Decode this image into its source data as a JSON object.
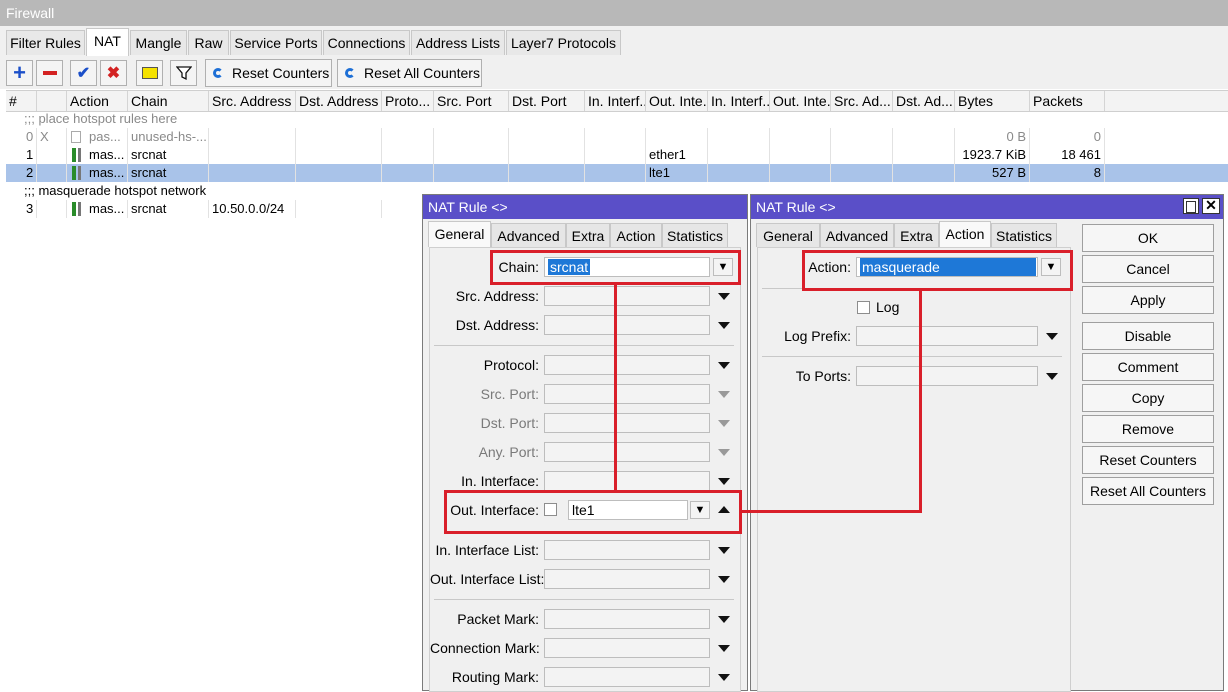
{
  "window_title": "Firewall",
  "main_tabs": [
    "Filter Rules",
    "NAT",
    "Mangle",
    "Raw",
    "Service Ports",
    "Connections",
    "Address Lists",
    "Layer7 Protocols"
  ],
  "toolbar": {
    "add_icon": "plus-icon",
    "remove_icon": "minus-icon",
    "enable_icon": "check-icon",
    "disable_icon": "cross-icon",
    "comment_icon": "note-icon",
    "filter_icon": "funnel-icon",
    "reset_counters": "Reset Counters",
    "reset_all_counters": "Reset All Counters"
  },
  "table": {
    "columns": [
      "#",
      "Action",
      "Chain",
      "Src. Address",
      "Dst. Address",
      "Proto...",
      "Src. Port",
      "Dst. Port",
      "In. Interf...",
      "Out. Inte...",
      "In. Interf...",
      "Out. Inte...",
      "Src. Ad...",
      "Dst. Ad...",
      "Bytes",
      "Packets"
    ],
    "comment1": ";;; place hotspot rules here",
    "rows": [
      {
        "num": "0",
        "flag": "X",
        "action": "pas...",
        "chain": "unused-hs-...",
        "src": "",
        "out": "",
        "bytes": "0 B",
        "packets": "0"
      },
      {
        "num": "1",
        "flag": "",
        "action": "mas...",
        "chain": "srcnat",
        "src": "",
        "out": "ether1",
        "bytes": "1923.7 KiB",
        "packets": "18 461"
      },
      {
        "num": "2",
        "flag": "",
        "action": "mas...",
        "chain": "srcnat",
        "src": "",
        "out": "lte1",
        "bytes": "527 B",
        "packets": "8"
      }
    ],
    "comment2": ";;; masquerade hotspot network",
    "row3": {
      "num": "3",
      "action": "mas...",
      "chain": "srcnat",
      "src": "10.50.0.0/24"
    }
  },
  "dialog1": {
    "title": "NAT Rule <>",
    "tabs": [
      "General",
      "Advanced",
      "Extra",
      "Action",
      "Statistics"
    ],
    "chain_label": "Chain:",
    "chain_value": "srcnat",
    "src_address_label": "Src. Address:",
    "dst_address_label": "Dst. Address:",
    "protocol_label": "Protocol:",
    "src_port_label": "Src. Port:",
    "dst_port_label": "Dst. Port:",
    "any_port_label": "Any. Port:",
    "in_interface_label": "In. Interface:",
    "out_interface_label": "Out. Interface:",
    "out_interface_value": "lte1",
    "in_interface_list_label": "In. Interface List:",
    "out_interface_list_label": "Out. Interface List:",
    "packet_mark_label": "Packet Mark:",
    "connection_mark_label": "Connection Mark:",
    "routing_mark_label": "Routing Mark:"
  },
  "dialog2": {
    "title": "NAT Rule <>",
    "tabs": [
      "General",
      "Advanced",
      "Extra",
      "Action",
      "Statistics"
    ],
    "action_label": "Action:",
    "action_value": "masquerade",
    "log_label": "Log",
    "log_prefix_label": "Log Prefix:",
    "to_ports_label": "To Ports:",
    "buttons": [
      "OK",
      "Cancel",
      "Apply",
      "Disable",
      "Comment",
      "Copy",
      "Remove",
      "Reset Counters",
      "Reset All Counters"
    ]
  },
  "colors": {
    "accent_title": "#5a4fc8",
    "highlight": "#d91f2a",
    "selection": "#a9c3e9"
  }
}
